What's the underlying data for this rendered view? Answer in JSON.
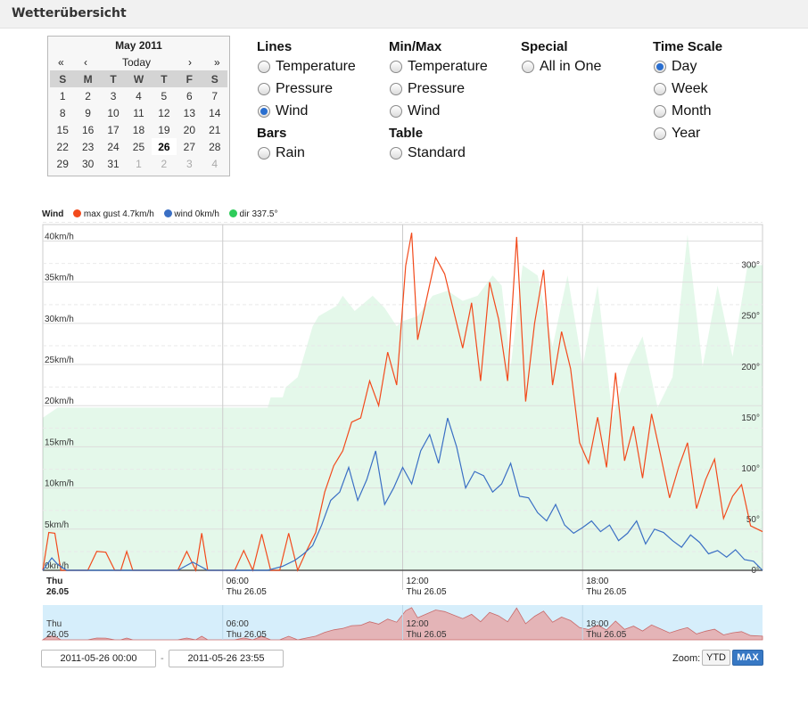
{
  "page": {
    "title": "Wetterübersicht"
  },
  "calendar": {
    "month_label": "May 2011",
    "nav": {
      "first": "«",
      "prev": "‹",
      "today": "Today",
      "next": "›",
      "last": "»"
    },
    "weekdays": [
      "S",
      "M",
      "T",
      "W",
      "T",
      "F",
      "S"
    ],
    "weeks": [
      [
        "1",
        "2",
        "3",
        "4",
        "5",
        "6",
        "7"
      ],
      [
        "8",
        "9",
        "10",
        "11",
        "12",
        "13",
        "14"
      ],
      [
        "15",
        "16",
        "17",
        "18",
        "19",
        "20",
        "21"
      ],
      [
        "22",
        "23",
        "24",
        "25",
        "26",
        "27",
        "28"
      ],
      [
        "29",
        "30",
        "31",
        "1",
        "2",
        "3",
        "4"
      ]
    ],
    "selected_day": "26"
  },
  "options": {
    "lines": {
      "title": "Lines",
      "items": [
        "Temperature",
        "Pressure",
        "Wind"
      ],
      "selected": "Wind"
    },
    "bars": {
      "title": "Bars",
      "items": [
        "Rain"
      ]
    },
    "minmax": {
      "title": "Min/Max",
      "items": [
        "Temperature",
        "Pressure",
        "Wind"
      ]
    },
    "table": {
      "title": "Table",
      "items": [
        "Standard"
      ]
    },
    "special": {
      "title": "Special",
      "items": [
        "All in One"
      ]
    },
    "timescale": {
      "title": "Time Scale",
      "items": [
        "Day",
        "Week",
        "Month",
        "Year"
      ],
      "selected": "Day"
    }
  },
  "legend": {
    "title": "Wind",
    "items": [
      {
        "label": "max gust 4.7km/h",
        "color": "#f24a1c"
      },
      {
        "label": "wind 0km/h",
        "color": "#3a6fc4"
      },
      {
        "label": "dir 337.5°",
        "color": "#2ecc5a"
      }
    ]
  },
  "chart_data": {
    "type": "line",
    "title": "Wind",
    "y_left_ticks": [
      "0km/h",
      "5km/h",
      "10km/h",
      "15km/h",
      "20km/h",
      "25km/h",
      "30km/h",
      "35km/h",
      "40km/h"
    ],
    "y_left_range": [
      0,
      42
    ],
    "y_right_ticks": [
      "0°",
      "50°",
      "100°",
      "150°",
      "200°",
      "250°",
      "300°"
    ],
    "y_right_range": [
      0,
      340
    ],
    "x_ticks": [
      {
        "time": "Thu",
        "date": "26.05",
        "hour": 0
      },
      {
        "time": "06:00",
        "date": "Thu 26.05",
        "hour": 6
      },
      {
        "time": "12:00",
        "date": "Thu 26.05",
        "hour": 12
      },
      {
        "time": "18:00",
        "date": "Thu 26.05",
        "hour": 18
      }
    ],
    "x_range_hours": [
      0,
      24
    ],
    "series": [
      {
        "name": "max gust",
        "color": "#f24a1c",
        "hours": [
          0,
          0.2,
          0.4,
          0.6,
          0.8,
          1.0,
          1.2,
          1.5,
          1.8,
          2.1,
          2.4,
          2.6,
          2.8,
          3.0,
          3.3,
          3.6,
          3.9,
          4.2,
          4.5,
          4.8,
          5.1,
          5.3,
          5.5,
          5.8,
          6.1,
          6.4,
          6.7,
          7.0,
          7.3,
          7.6,
          7.9,
          8.2,
          8.5,
          8.8,
          9.1,
          9.4,
          9.7,
          10.0,
          10.3,
          10.6,
          10.9,
          11.2,
          11.5,
          11.8,
          12.1,
          12.3,
          12.5,
          12.8,
          13.1,
          13.4,
          13.7,
          14.0,
          14.3,
          14.6,
          14.9,
          15.2,
          15.5,
          15.8,
          16.1,
          16.4,
          16.7,
          17.0,
          17.3,
          17.6,
          17.9,
          18.2,
          18.5,
          18.8,
          19.1,
          19.4,
          19.7,
          20.0,
          20.3,
          20.6,
          20.9,
          21.2,
          21.5,
          21.8,
          22.1,
          22.4,
          22.7,
          23.0,
          23.3,
          23.6,
          24.0
        ],
        "values": [
          0,
          4.6,
          4.5,
          0,
          0,
          0,
          0,
          0,
          2.3,
          2.2,
          0,
          0,
          2.3,
          0,
          0,
          0,
          0,
          0,
          0,
          2.3,
          0,
          4.5,
          0,
          0,
          0,
          0,
          2.4,
          0,
          4.4,
          0,
          0,
          4.5,
          0,
          2.4,
          4.6,
          9.5,
          12.7,
          14.5,
          18,
          18.5,
          23,
          20,
          26.5,
          22.5,
          37,
          41,
          28,
          33,
          38,
          36,
          31.5,
          27,
          32.5,
          23,
          35,
          30.5,
          23,
          40.5,
          20.5,
          30,
          36.5,
          22.5,
          29,
          24.5,
          15.5,
          13,
          18.6,
          12.5,
          24,
          13.3,
          17.5,
          11.2,
          19,
          14,
          8.8,
          12.5,
          15.5,
          7.5,
          11,
          13.5,
          6.3,
          9,
          10.4,
          5.4,
          4.7
        ]
      },
      {
        "name": "wind",
        "color": "#3a6fc4",
        "hours": [
          0,
          0.3,
          0.5,
          0.8,
          1.1,
          1.5,
          2.0,
          2.5,
          3.0,
          3.5,
          4.0,
          4.5,
          5.0,
          5.5,
          6.0,
          6.5,
          7.0,
          7.5,
          8.0,
          8.4,
          8.7,
          9.0,
          9.3,
          9.6,
          9.9,
          10.2,
          10.5,
          10.8,
          11.1,
          11.4,
          11.7,
          12.0,
          12.3,
          12.6,
          12.9,
          13.2,
          13.5,
          13.8,
          14.1,
          14.4,
          14.7,
          15.0,
          15.3,
          15.6,
          15.9,
          16.2,
          16.5,
          16.8,
          17.1,
          17.4,
          17.7,
          18.0,
          18.3,
          18.6,
          18.9,
          19.2,
          19.5,
          19.8,
          20.1,
          20.4,
          20.7,
          21.0,
          21.3,
          21.6,
          21.9,
          22.2,
          22.5,
          22.8,
          23.1,
          23.4,
          23.7,
          24.0
        ],
        "values": [
          0,
          1.5,
          0.7,
          0,
          0,
          0,
          0,
          0,
          0,
          0,
          0,
          0,
          1,
          0,
          0,
          0,
          0,
          0,
          0.5,
          1.2,
          2,
          3,
          5.5,
          8.5,
          9.5,
          12.5,
          8.5,
          11,
          14.5,
          8,
          10,
          12.5,
          10.5,
          14.5,
          16.5,
          13,
          18.5,
          15,
          10,
          12,
          11.5,
          9.5,
          10.5,
          13,
          9,
          8.8,
          7,
          6,
          8,
          5.5,
          4.5,
          5.2,
          6,
          4.7,
          5.5,
          3.6,
          4.5,
          6,
          3.2,
          5,
          4.6,
          3.6,
          2.8,
          4.3,
          3.4,
          2,
          2.4,
          1.6,
          2.5,
          1.3,
          1.1,
          0
        ]
      },
      {
        "name": "dir",
        "color": "#2ecc5a",
        "axis": "right",
        "hours": [
          0,
          0.5,
          7.5,
          7.6,
          8.0,
          8.1,
          8.5,
          9.0,
          9.2,
          9.5,
          9.8,
          10.0,
          10.4,
          11.0,
          11.4,
          11.8,
          12.0,
          12.5,
          13.0,
          13.5,
          14.0,
          14.5,
          15.0,
          15.3,
          15.6,
          16.0,
          16.5,
          17.0,
          17.5,
          18.0,
          18.5,
          19.0,
          19.5,
          20.0,
          20.5,
          21.0,
          21.5,
          22.0,
          22.5,
          23.0,
          23.5,
          24.0
        ],
        "values": [
          150,
          160,
          160,
          170,
          170,
          180,
          190,
          240,
          250,
          255,
          260,
          270,
          255,
          270,
          258,
          240,
          245,
          250,
          270,
          275,
          265,
          270,
          290,
          280,
          200,
          300,
          290,
          220,
          290,
          200,
          280,
          150,
          200,
          230,
          160,
          190,
          330,
          200,
          280,
          210,
          300,
          300
        ]
      }
    ]
  },
  "navigator": {
    "labels": [
      {
        "time": "Thu",
        "date": "26.05"
      },
      {
        "time": "06:00",
        "date": "Thu 26.05"
      },
      {
        "time": "12:00",
        "date": "Thu 26.05"
      },
      {
        "time": "18:00",
        "date": "Thu 26.05"
      }
    ]
  },
  "range": {
    "from": "2011-05-26 00:00",
    "separator": "-",
    "to": "2011-05-26 23:55"
  },
  "zoom": {
    "label": "Zoom:",
    "ytd": "YTD",
    "max": "MAX"
  }
}
